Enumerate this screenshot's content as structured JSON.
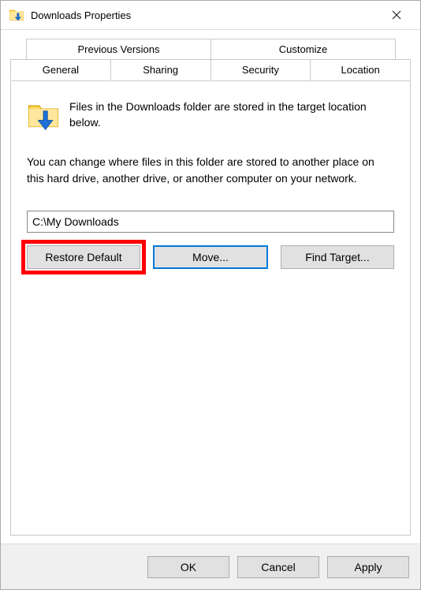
{
  "title": "Downloads Properties",
  "tabs": {
    "top": [
      "Previous Versions",
      "Customize"
    ],
    "bottom": [
      "General",
      "Sharing",
      "Security",
      "Location"
    ],
    "active": "Location"
  },
  "content": {
    "heading": "Files in the Downloads folder are stored in the target location below.",
    "description": "You can change where files in this folder are stored to another place on this hard drive, another drive, or another computer on your network.",
    "path_value": "C:\\My Downloads",
    "buttons": {
      "restore": "Restore Default",
      "move": "Move...",
      "find": "Find Target..."
    }
  },
  "dialog_buttons": {
    "ok": "OK",
    "cancel": "Cancel",
    "apply": "Apply"
  }
}
